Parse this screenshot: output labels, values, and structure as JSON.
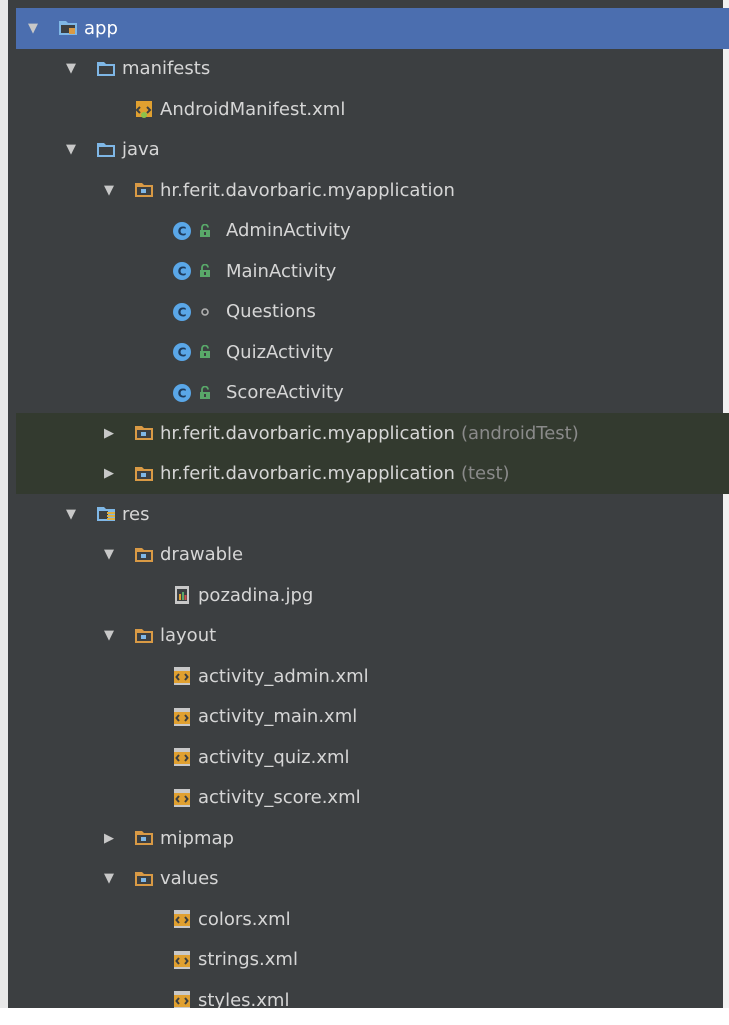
{
  "tree": {
    "rows": [
      {
        "id": "app",
        "label": "app",
        "depth": 0,
        "arrow": "expanded",
        "icon": "module-folder-icon",
        "selected": true
      },
      {
        "id": "manifests",
        "label": "manifests",
        "depth": 1,
        "arrow": "expanded",
        "icon": "folder-icon"
      },
      {
        "id": "android-manifest",
        "label": "AndroidManifest.xml",
        "depth": 2,
        "arrow": "none",
        "icon": "manifest-file-icon"
      },
      {
        "id": "java",
        "label": "java",
        "depth": 1,
        "arrow": "expanded",
        "icon": "folder-icon"
      },
      {
        "id": "package-main",
        "label": "hr.ferit.davorbaric.myapplication",
        "depth": 2,
        "arrow": "expanded",
        "icon": "package-icon"
      },
      {
        "id": "admin-activity",
        "label": "AdminActivity",
        "depth": 3,
        "arrow": "none",
        "icon": "class-icon",
        "visibility": "public-lock-icon"
      },
      {
        "id": "main-activity",
        "label": "MainActivity",
        "depth": 3,
        "arrow": "none",
        "icon": "class-icon",
        "visibility": "public-lock-icon"
      },
      {
        "id": "questions",
        "label": "Questions",
        "depth": 3,
        "arrow": "none",
        "icon": "class-icon",
        "visibility": "package-private-dot-icon"
      },
      {
        "id": "quiz-activity",
        "label": "QuizActivity",
        "depth": 3,
        "arrow": "none",
        "icon": "class-icon",
        "visibility": "public-lock-icon"
      },
      {
        "id": "score-activity",
        "label": "ScoreActivity",
        "depth": 3,
        "arrow": "none",
        "icon": "class-icon",
        "visibility": "public-lock-icon"
      },
      {
        "id": "package-android-test",
        "label": "hr.ferit.davorbaric.myapplication",
        "suffix": "(androidTest)",
        "depth": 2,
        "arrow": "collapsed",
        "icon": "package-icon",
        "test": true
      },
      {
        "id": "package-test",
        "label": "hr.ferit.davorbaric.myapplication",
        "suffix": "(test)",
        "depth": 2,
        "arrow": "collapsed",
        "icon": "package-icon",
        "test": true
      },
      {
        "id": "res",
        "label": "res",
        "depth": 1,
        "arrow": "expanded",
        "icon": "resources-folder-icon"
      },
      {
        "id": "drawable",
        "label": "drawable",
        "depth": 2,
        "arrow": "expanded",
        "icon": "package-icon"
      },
      {
        "id": "pozadina",
        "label": "pozadina.jpg",
        "depth": 3,
        "arrow": "none",
        "icon": "image-file-icon"
      },
      {
        "id": "layout",
        "label": "layout",
        "depth": 2,
        "arrow": "expanded",
        "icon": "package-icon"
      },
      {
        "id": "activity-admin",
        "label": "activity_admin.xml",
        "depth": 3,
        "arrow": "none",
        "icon": "xml-file-icon"
      },
      {
        "id": "activity-main",
        "label": "activity_main.xml",
        "depth": 3,
        "arrow": "none",
        "icon": "xml-file-icon"
      },
      {
        "id": "activity-quiz",
        "label": "activity_quiz.xml",
        "depth": 3,
        "arrow": "none",
        "icon": "xml-file-icon"
      },
      {
        "id": "activity-score",
        "label": "activity_score.xml",
        "depth": 3,
        "arrow": "none",
        "icon": "xml-file-icon"
      },
      {
        "id": "mipmap",
        "label": "mipmap",
        "depth": 2,
        "arrow": "collapsed",
        "icon": "package-icon"
      },
      {
        "id": "values",
        "label": "values",
        "depth": 2,
        "arrow": "expanded",
        "icon": "package-icon"
      },
      {
        "id": "colors",
        "label": "colors.xml",
        "depth": 3,
        "arrow": "none",
        "icon": "xml-file-icon"
      },
      {
        "id": "strings",
        "label": "strings.xml",
        "depth": 3,
        "arrow": "none",
        "icon": "xml-file-icon"
      },
      {
        "id": "styles",
        "label": "styles.xml",
        "depth": 3,
        "arrow": "none",
        "icon": "xml-file-icon"
      }
    ]
  },
  "colors": {
    "background": "#3c3f41",
    "selection": "#4b6eaf",
    "test_rows": "#333a2f",
    "folder_blue": "#7fb7e6",
    "package_orange": "#d99a45",
    "class_blue": "#5aa7e8",
    "lock_green": "#59a869",
    "xml_orange": "#e0a030"
  }
}
